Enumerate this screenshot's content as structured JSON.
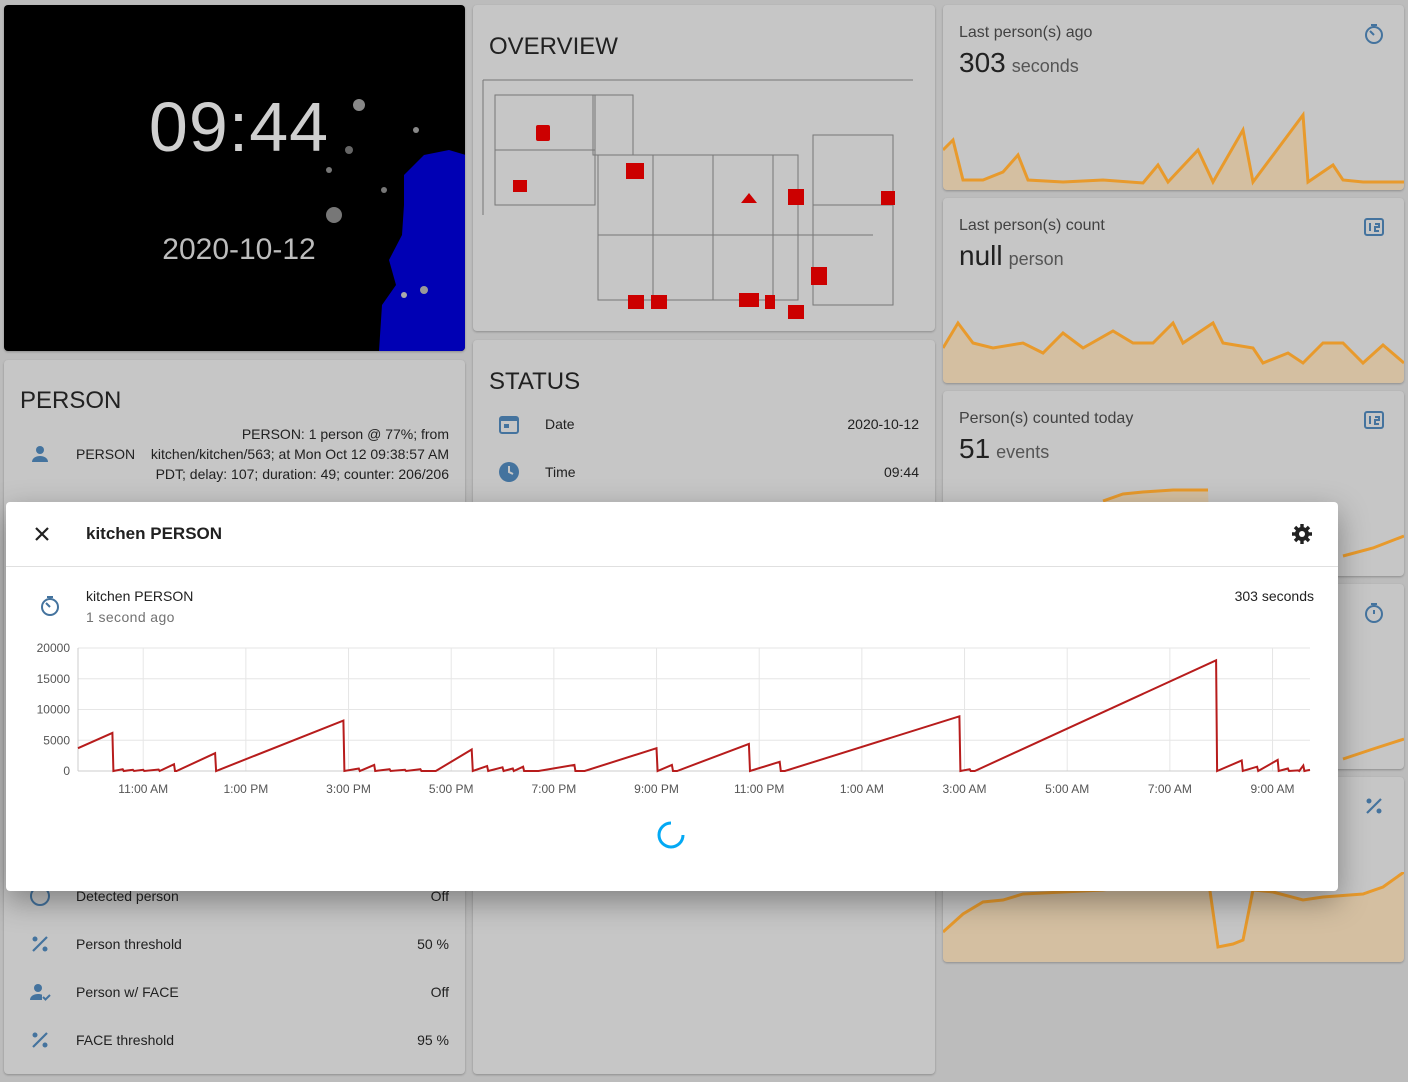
{
  "clock": {
    "time": "09:44",
    "date": "2020-10-12"
  },
  "overview": {
    "title": "OVERVIEW"
  },
  "person": {
    "title": "PERSON",
    "state_label": "PERSON",
    "state_text": "PERSON: 1 person @ 77%; from kitchen/kitchen/563; at Mon Oct 12 09:38:57 AM PDT; delay: 107; duration: 49; counter: 206/206",
    "rows": [
      {
        "label": "Detected person",
        "value": "Off",
        "icon": "circle-outline-icon"
      },
      {
        "label": "Person threshold",
        "value": "50 %",
        "icon": "percent-icon"
      },
      {
        "label": "Person w/ FACE",
        "value": "Off",
        "icon": "account-check-icon"
      },
      {
        "label": "FACE threshold",
        "value": "95 %",
        "icon": "percent-icon"
      }
    ]
  },
  "status": {
    "title": "STATUS",
    "rows": [
      {
        "label": "Date",
        "value": "2020-10-12",
        "icon": "calendar-icon"
      },
      {
        "label": "Time",
        "value": "09:44",
        "icon": "clock-icon"
      }
    ]
  },
  "sensors": [
    {
      "name": "Last person(s) ago",
      "value": "303",
      "unit": "seconds",
      "icon": "timer-icon"
    },
    {
      "name": "Last person(s) count",
      "value": "null",
      "unit": "person",
      "icon": "counter-icon"
    },
    {
      "name": "Person(s) counted today",
      "value": "51",
      "unit": "events",
      "icon": "counter-icon"
    },
    {
      "name": "",
      "value": "",
      "unit": "",
      "icon": "stopwatch-icon"
    },
    {
      "name": "",
      "value": "",
      "unit": "",
      "icon": "percent-icon"
    }
  ],
  "dialog": {
    "title": "kitchen PERSON",
    "entity_name": "kitchen PERSON",
    "entity_ago": "1 second ago",
    "entity_state": "303 seconds",
    "accent": "#b71c1c"
  },
  "chart_data": {
    "type": "line",
    "x_ticks": [
      "11:00 AM",
      "1:00 PM",
      "3:00 PM",
      "5:00 PM",
      "7:00 PM",
      "9:00 PM",
      "11:00 PM",
      "1:00 AM",
      "3:00 AM",
      "5:00 AM",
      "7:00 AM",
      "9:00 AM"
    ],
    "y_ticks": [
      0,
      5000,
      10000,
      15000,
      20000
    ],
    "ylim": [
      0,
      20000
    ],
    "xlim_hours": [
      9.73,
      33.73
    ],
    "grid": true,
    "series": [
      {
        "color": "#b71c1c",
        "points": [
          [
            9.73,
            3700
          ],
          [
            10.4,
            6200
          ],
          [
            10.42,
            0
          ],
          [
            10.6,
            300
          ],
          [
            10.62,
            0
          ],
          [
            10.8,
            200
          ],
          [
            10.82,
            0
          ],
          [
            11.0,
            200
          ],
          [
            11.02,
            0
          ],
          [
            11.3,
            250
          ],
          [
            11.32,
            0
          ],
          [
            11.6,
            1100
          ],
          [
            11.62,
            0
          ],
          [
            11.65,
            0
          ],
          [
            12.4,
            2900
          ],
          [
            12.42,
            0
          ],
          [
            14.9,
            8200
          ],
          [
            14.92,
            0
          ],
          [
            15.2,
            400
          ],
          [
            15.22,
            0
          ],
          [
            15.5,
            1000
          ],
          [
            15.52,
            0
          ],
          [
            15.8,
            300
          ],
          [
            15.82,
            0
          ],
          [
            16.1,
            200
          ],
          [
            16.12,
            0
          ],
          [
            16.4,
            300
          ],
          [
            16.42,
            0
          ],
          [
            16.7,
            0
          ],
          [
            17.4,
            3500
          ],
          [
            17.42,
            0
          ],
          [
            17.7,
            800
          ],
          [
            17.72,
            0
          ],
          [
            18.0,
            600
          ],
          [
            18.02,
            0
          ],
          [
            18.2,
            400
          ],
          [
            18.22,
            0
          ],
          [
            18.4,
            700
          ],
          [
            18.42,
            0
          ],
          [
            18.7,
            0
          ],
          [
            19.4,
            1000
          ],
          [
            19.42,
            0
          ],
          [
            19.6,
            0
          ],
          [
            21.0,
            3700
          ],
          [
            21.02,
            0
          ],
          [
            21.3,
            1000
          ],
          [
            21.32,
            0
          ],
          [
            21.4,
            0
          ],
          [
            22.8,
            4400
          ],
          [
            22.82,
            0
          ],
          [
            23.4,
            1500
          ],
          [
            23.42,
            0
          ],
          [
            23.5,
            0
          ],
          [
            26.9,
            8900
          ],
          [
            26.92,
            0
          ],
          [
            27.1,
            300
          ],
          [
            27.12,
            0
          ],
          [
            27.2,
            0
          ],
          [
            31.9,
            18000
          ],
          [
            31.92,
            0
          ],
          [
            32.4,
            1700
          ],
          [
            32.42,
            0
          ],
          [
            32.7,
            700
          ],
          [
            32.72,
            0
          ],
          [
            33.1,
            1800
          ],
          [
            33.12,
            0
          ],
          [
            33.3,
            400
          ],
          [
            33.32,
            0
          ],
          [
            33.5,
            100
          ],
          [
            33.52,
            0
          ],
          [
            33.6,
            900
          ],
          [
            33.62,
            0
          ],
          [
            33.73,
            200
          ]
        ]
      }
    ]
  }
}
